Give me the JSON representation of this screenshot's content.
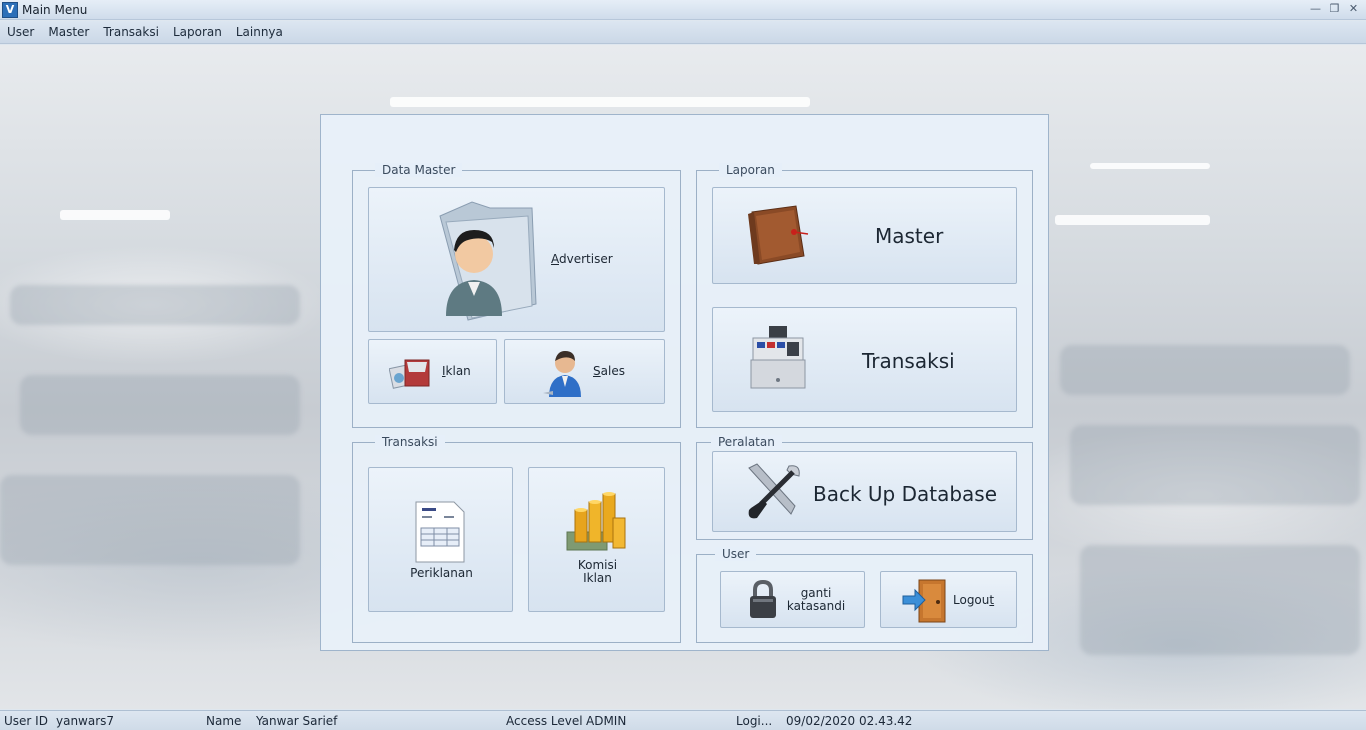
{
  "window": {
    "title": "Main Menu"
  },
  "menu": [
    "User",
    "Master",
    "Transaksi",
    "Laporan",
    "Lainnya"
  ],
  "groups": {
    "data_master": "Data Master",
    "laporan": "Laporan",
    "transaksi": "Transaksi",
    "peralatan": "Peralatan",
    "user": "User"
  },
  "tiles": {
    "advertiser": {
      "prefix": "",
      "accel": "A",
      "rest": "dvertiser"
    },
    "iklan": {
      "accel": "I",
      "rest": "klan"
    },
    "sales": {
      "accel": "S",
      "rest": "ales"
    },
    "laporan_master": "Master",
    "laporan_transaksi": "Transaksi",
    "backup": "Back Up Database",
    "periklanan": "Periklanan",
    "komisi_line1": "Komisi",
    "komisi_line2": "Iklan",
    "ganti_line1": "ganti",
    "ganti_line2": "katasandi",
    "logout": {
      "prefix": "Logou",
      "accel": "t"
    }
  },
  "status": {
    "user_id_label": "User ID",
    "user_id_value": "yanwars7",
    "name_label": "Name",
    "name_value": "Yanwar Sarief",
    "access_label": "Access Level",
    "access_value": "ADMIN",
    "login_label": "Logi...",
    "login_value": "09/02/2020 02.43.42"
  },
  "icons": [
    "app-icon",
    "folder-user-icon",
    "advert-icon",
    "sales-person-icon",
    "ledger-book-icon",
    "cash-register-icon",
    "tools-icon",
    "invoice-icon",
    "coins-icon",
    "padlock-icon",
    "door-exit-icon"
  ],
  "colors": {
    "panel": "#e8f1fa",
    "tile": "#dbe6f2",
    "border": "#9cb0c6"
  }
}
